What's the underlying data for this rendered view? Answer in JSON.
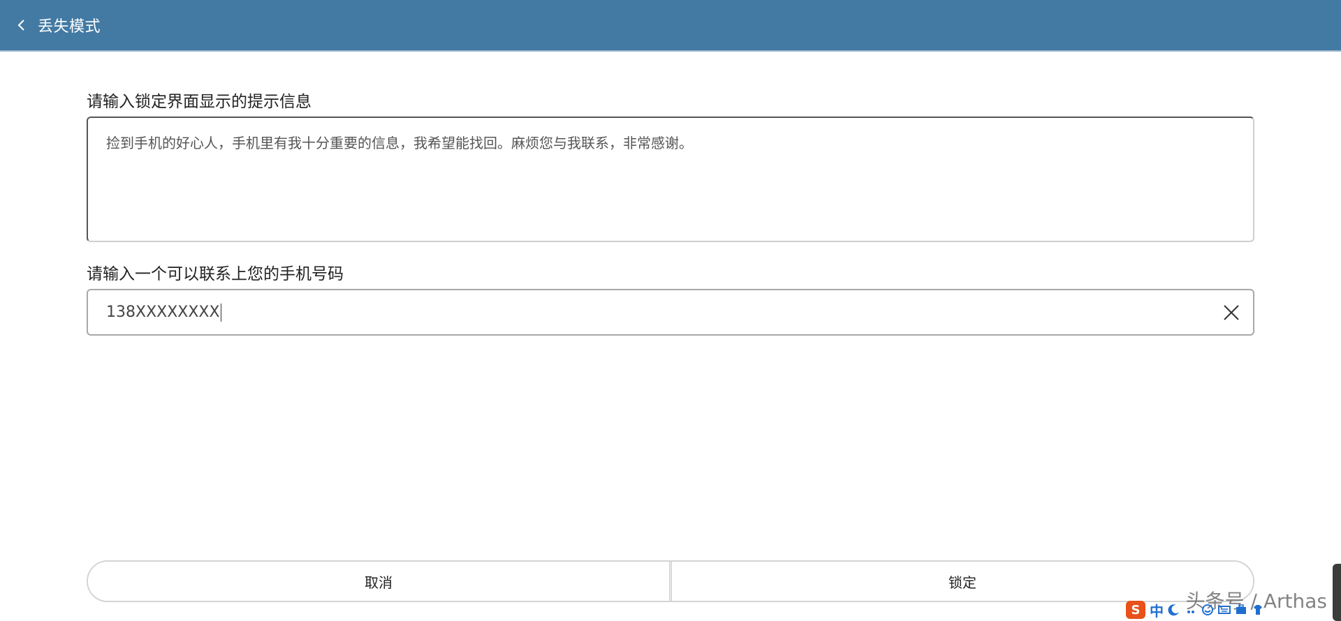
{
  "header": {
    "title": "丢失模式"
  },
  "message": {
    "label": "请输入锁定界面显示的提示信息",
    "value": "捡到手机的好心人，手机里有我十分重要的信息，我希望能找回。麻烦您与我联系，非常感谢。"
  },
  "phone": {
    "label": "请输入一个可以联系上您的手机号码",
    "value": "138XXXXXXXX"
  },
  "actions": {
    "cancel_label": "取消",
    "lock_label": "锁定"
  },
  "watermark": "头条号 / Arthas",
  "ime": {
    "logo": "S",
    "mode_label": "中"
  },
  "colors": {
    "header_bg": "#437aa3",
    "ime_logo": "#e8511a",
    "ime_accent": "#1f6fd1"
  }
}
